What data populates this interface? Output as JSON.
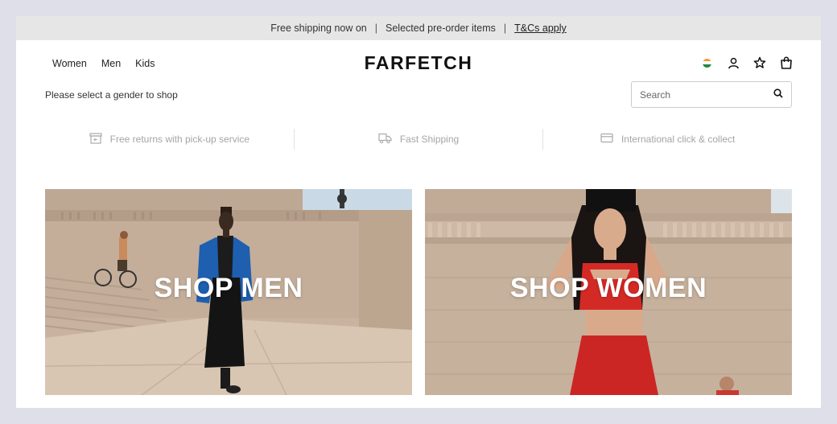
{
  "promo": {
    "text1": "Free shipping now on",
    "sep": "|",
    "text2": "Selected pre-order items",
    "link": "T&Cs apply"
  },
  "nav": {
    "items": [
      "Women",
      "Men",
      "Kids"
    ],
    "logo": "FARFETCH",
    "icons": [
      "india-flag-icon",
      "account-icon",
      "wishlist-star-icon",
      "shopping-bag-icon"
    ]
  },
  "gender_note": "Please select a gender to shop",
  "search": {
    "placeholder": "Search"
  },
  "benefits": [
    {
      "icon": "returns-box-icon",
      "label": "Free returns with pick-up service"
    },
    {
      "icon": "truck-icon",
      "label": "Fast Shipping"
    },
    {
      "icon": "card-icon",
      "label": "International click & collect"
    }
  ],
  "heroes": {
    "men": {
      "label": "SHOP MEN"
    },
    "women": {
      "label": "SHOP WOMEN"
    }
  },
  "colors": {
    "promo_bg": "#e6e6e6",
    "page_bg": "#dfdfe9",
    "muted_text": "#a5a5a5",
    "men_jacket": "#1f5fb0",
    "women_outfit": "#d42a26"
  }
}
